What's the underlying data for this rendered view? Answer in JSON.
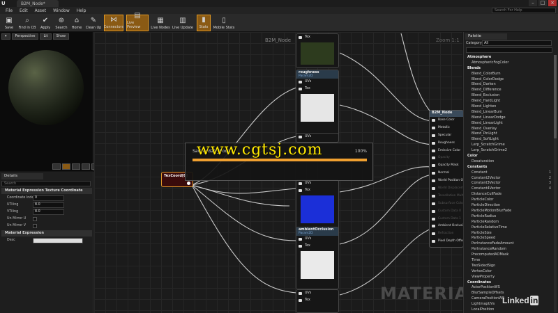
{
  "titlebar": {
    "logo": "U",
    "tab": "B2M_Node*",
    "min": "–",
    "max": "□",
    "close": "×"
  },
  "menu": [
    "File",
    "Edit",
    "Asset",
    "Window",
    "Help"
  ],
  "help_search_placeholder": "Search For Help",
  "toolbar": [
    {
      "label": "Save",
      "icon": "save-icon"
    },
    {
      "label": "Find in CB",
      "icon": "search-icon"
    },
    {
      "label": "Apply",
      "icon": "apply-icon"
    },
    {
      "label": "Search",
      "icon": "binoculars-icon"
    },
    {
      "label": "Home",
      "icon": "home-icon"
    },
    {
      "label": "Clean Up",
      "icon": "broom-icon"
    },
    {
      "label": "Connectors",
      "icon": "connectors-icon"
    },
    {
      "label": "Live Preview",
      "icon": "live-preview-icon"
    },
    {
      "label": "Live Nodes",
      "icon": "live-nodes-icon"
    },
    {
      "label": "Live Update",
      "icon": "live-update-icon"
    },
    {
      "label": "Stats",
      "icon": "stats-icon"
    },
    {
      "label": "Mobile Stats",
      "icon": "mobile-stats-icon"
    }
  ],
  "viewport": {
    "buttons": [
      "Perspective",
      "Lit",
      "Show"
    ]
  },
  "details": {
    "tab": "Details",
    "search_placeholder": "Search",
    "section1": "Material Expression Texture Coordinate",
    "props": [
      {
        "label": "Coordinate Index",
        "value": "0"
      },
      {
        "label": "UTiling",
        "value": "8.0"
      },
      {
        "label": "VTiling",
        "value": "8.0"
      },
      {
        "label": "Un Mirror U",
        "value": ""
      },
      {
        "label": "Un Mirror V",
        "value": ""
      }
    ],
    "section2": "Material Expression",
    "desc_label": "Desc"
  },
  "graph": {
    "title": "B2M_Node",
    "zoom": "Zoom 1:1",
    "watermark": "MATERIAL"
  },
  "nodes": {
    "roughness": {
      "title": "roughness",
      "sub": "Param2D",
      "pins": [
        "UVs",
        "Tex"
      ],
      "label_above": "Tex"
    },
    "normal_mid": {
      "pins": [
        "UVs",
        "Tex"
      ]
    },
    "ao": {
      "title": "ambientOcclusion",
      "sub": "Param2D",
      "pins": [
        "UVs",
        "Tex"
      ]
    },
    "bottom": {
      "pins": [
        "UVs",
        "Tex"
      ]
    },
    "texcoord": {
      "title": "TexCoord[0]"
    }
  },
  "b2m_node": {
    "title": "B2M_Node",
    "pins": [
      "Base Color",
      "Metallic",
      "Specular",
      "Roughness",
      "Emissive Color",
      "Opacity",
      "Opacity Mask",
      "Normal",
      "World Position Offset",
      "World Displacement",
      "Tessellation Multiplier",
      "Subsurface Color",
      "Custom Data 0",
      "Custom Data 1",
      "Ambient Occlusion",
      "Refraction",
      "Pixel Depth Offset"
    ],
    "active": [
      true,
      true,
      true,
      true,
      true,
      false,
      true,
      true,
      true,
      false,
      false,
      false,
      false,
      false,
      true,
      false,
      true
    ]
  },
  "save_dialog": {
    "text": "Saving B2M_Node...",
    "percent": "100%"
  },
  "watermark_site": "www.cgtsj.com",
  "palette": {
    "tab": "Palette",
    "category_label": "Category",
    "category_value": "All",
    "items": [
      {
        "t": "Atmosphere",
        "cat": true
      },
      {
        "t": "AtmosphericFogColor"
      },
      {
        "t": "Blends",
        "cat": true
      },
      {
        "t": "Blend_ColorBurn"
      },
      {
        "t": "Blend_ColorDodge"
      },
      {
        "t": "Blend_Darken"
      },
      {
        "t": "Blend_Difference"
      },
      {
        "t": "Blend_Exclusion"
      },
      {
        "t": "Blend_HardLight"
      },
      {
        "t": "Blend_Lighten"
      },
      {
        "t": "Blend_LinearBurn"
      },
      {
        "t": "Blend_LinearDodge"
      },
      {
        "t": "Blend_LinearLight"
      },
      {
        "t": "Blend_Overlay"
      },
      {
        "t": "Blend_PinLight"
      },
      {
        "t": "Blend_SoftLight"
      },
      {
        "t": "Lerp_ScratchGrime"
      },
      {
        "t": "Lerp_ScratchGrime2"
      },
      {
        "t": "Color",
        "cat": true
      },
      {
        "t": "Desaturation"
      },
      {
        "t": "Constants",
        "cat": true
      },
      {
        "t": "Constant",
        "hk": "1"
      },
      {
        "t": "Constant2Vector",
        "hk": "2"
      },
      {
        "t": "Constant3Vector",
        "hk": "3"
      },
      {
        "t": "Constant4Vector",
        "hk": "4"
      },
      {
        "t": "DistanceCullFade"
      },
      {
        "t": "ParticleColor"
      },
      {
        "t": "ParticleDirection"
      },
      {
        "t": "ParticleMotionBlurFade"
      },
      {
        "t": "ParticleRadius"
      },
      {
        "t": "ParticleRandom"
      },
      {
        "t": "ParticleRelativeTime"
      },
      {
        "t": "ParticleSize"
      },
      {
        "t": "ParticleSpeed"
      },
      {
        "t": "PerInstanceFadeAmount"
      },
      {
        "t": "PerInstanceRandom"
      },
      {
        "t": "PrecomputedAOMask"
      },
      {
        "t": "Time"
      },
      {
        "t": "TwoSidedSign"
      },
      {
        "t": "VertexColor"
      },
      {
        "t": "ViewProperty"
      },
      {
        "t": "Coordinates",
        "cat": true
      },
      {
        "t": "ActorPositionWS"
      },
      {
        "t": "BlurSampleOffsets"
      },
      {
        "t": "CameraPositionWS"
      },
      {
        "t": "LightmapUVs"
      },
      {
        "t": "LocalPosition"
      }
    ]
  },
  "linkedin": {
    "text": "Linked",
    "in": "in"
  },
  "colors": {
    "accent": "#e59a22",
    "node_header": "#2a3b4a",
    "texcoord": "#3a0b0b",
    "watermark": "#ffe800"
  }
}
